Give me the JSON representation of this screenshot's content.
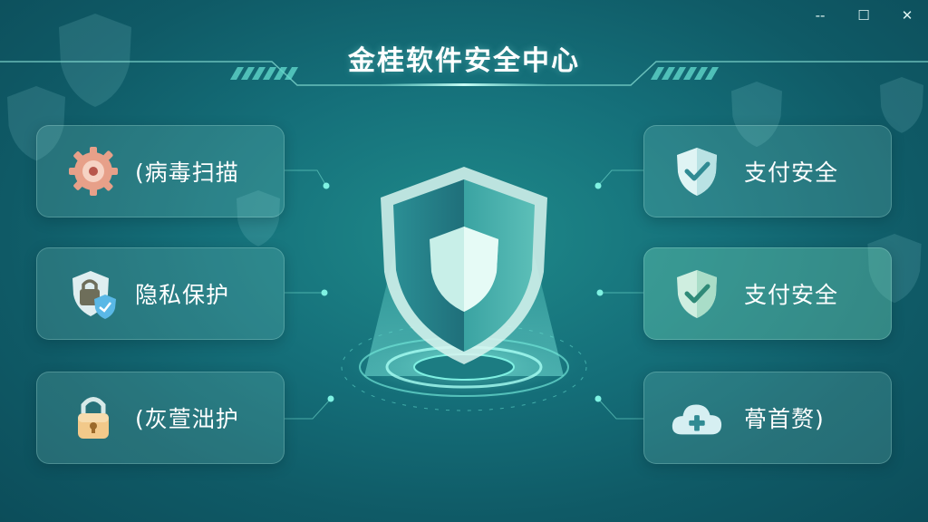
{
  "window": {
    "title": "金桂软件安全中心",
    "controls": {
      "minimize": "--",
      "maximize": "☐",
      "close": "✕"
    }
  },
  "left_cards": [
    {
      "label": "(病毒扫描",
      "icon": "gear-icon"
    },
    {
      "label": "隐私保护",
      "icon": "lock-shield-icon"
    },
    {
      "label": "(灰萱泏护",
      "icon": "padlock-icon"
    }
  ],
  "right_cards": [
    {
      "label": "支付安全",
      "icon": "shield-check-icon"
    },
    {
      "label": "支付安全",
      "icon": "shield-check-icon",
      "active": true
    },
    {
      "label": "蓇首赘)",
      "icon": "cloud-plus-icon"
    }
  ],
  "center": {
    "icon": "large-shield-icon"
  },
  "colors": {
    "accent": "#5fd6c9",
    "background": "#15707a",
    "card_active": "#5fc7a8"
  }
}
